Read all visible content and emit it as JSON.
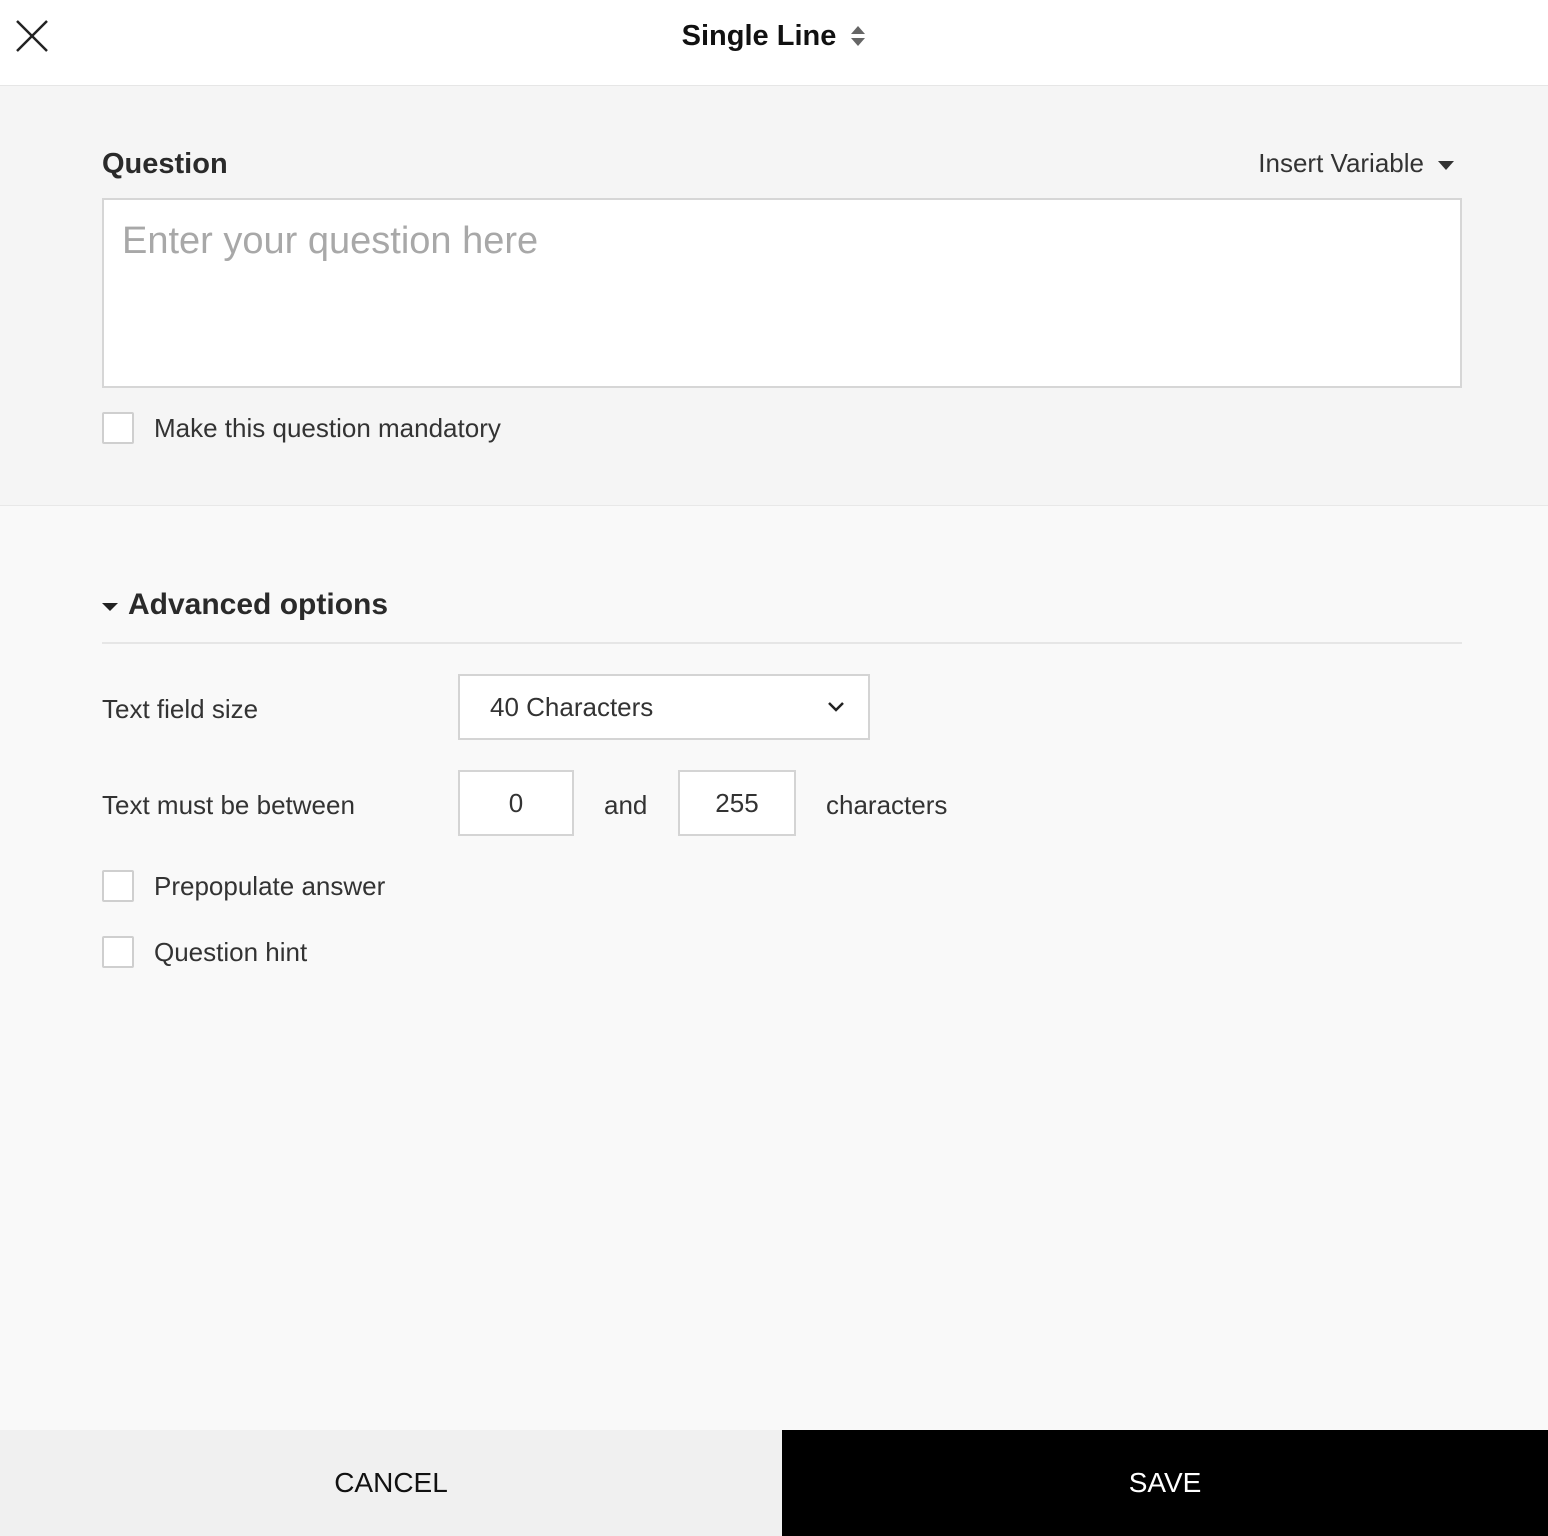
{
  "header": {
    "title": "Single Line",
    "close_icon": "close-icon",
    "type_switch_icon": "sort-arrows-icon"
  },
  "question": {
    "label": "Question",
    "insert_variable_label": "Insert Variable",
    "placeholder": "Enter your question here",
    "value": "",
    "mandatory_label": "Make this question mandatory",
    "mandatory_checked": false
  },
  "advanced": {
    "title": "Advanced options",
    "expanded": true,
    "text_field_size_label": "Text field size",
    "text_field_size_value": "40 Characters",
    "length_label": "Text must be between",
    "min_length": "0",
    "and_label": "and",
    "max_length": "255",
    "characters_label": "characters",
    "prepopulate_label": "Prepopulate answer",
    "prepopulate_checked": false,
    "hint_label": "Question hint",
    "hint_checked": false
  },
  "footer": {
    "cancel_label": "CANCEL",
    "save_label": "SAVE"
  },
  "colors": {
    "save_background": "#000000",
    "cancel_background": "#f0f0f0",
    "question_section_background": "#f5f5f5"
  }
}
